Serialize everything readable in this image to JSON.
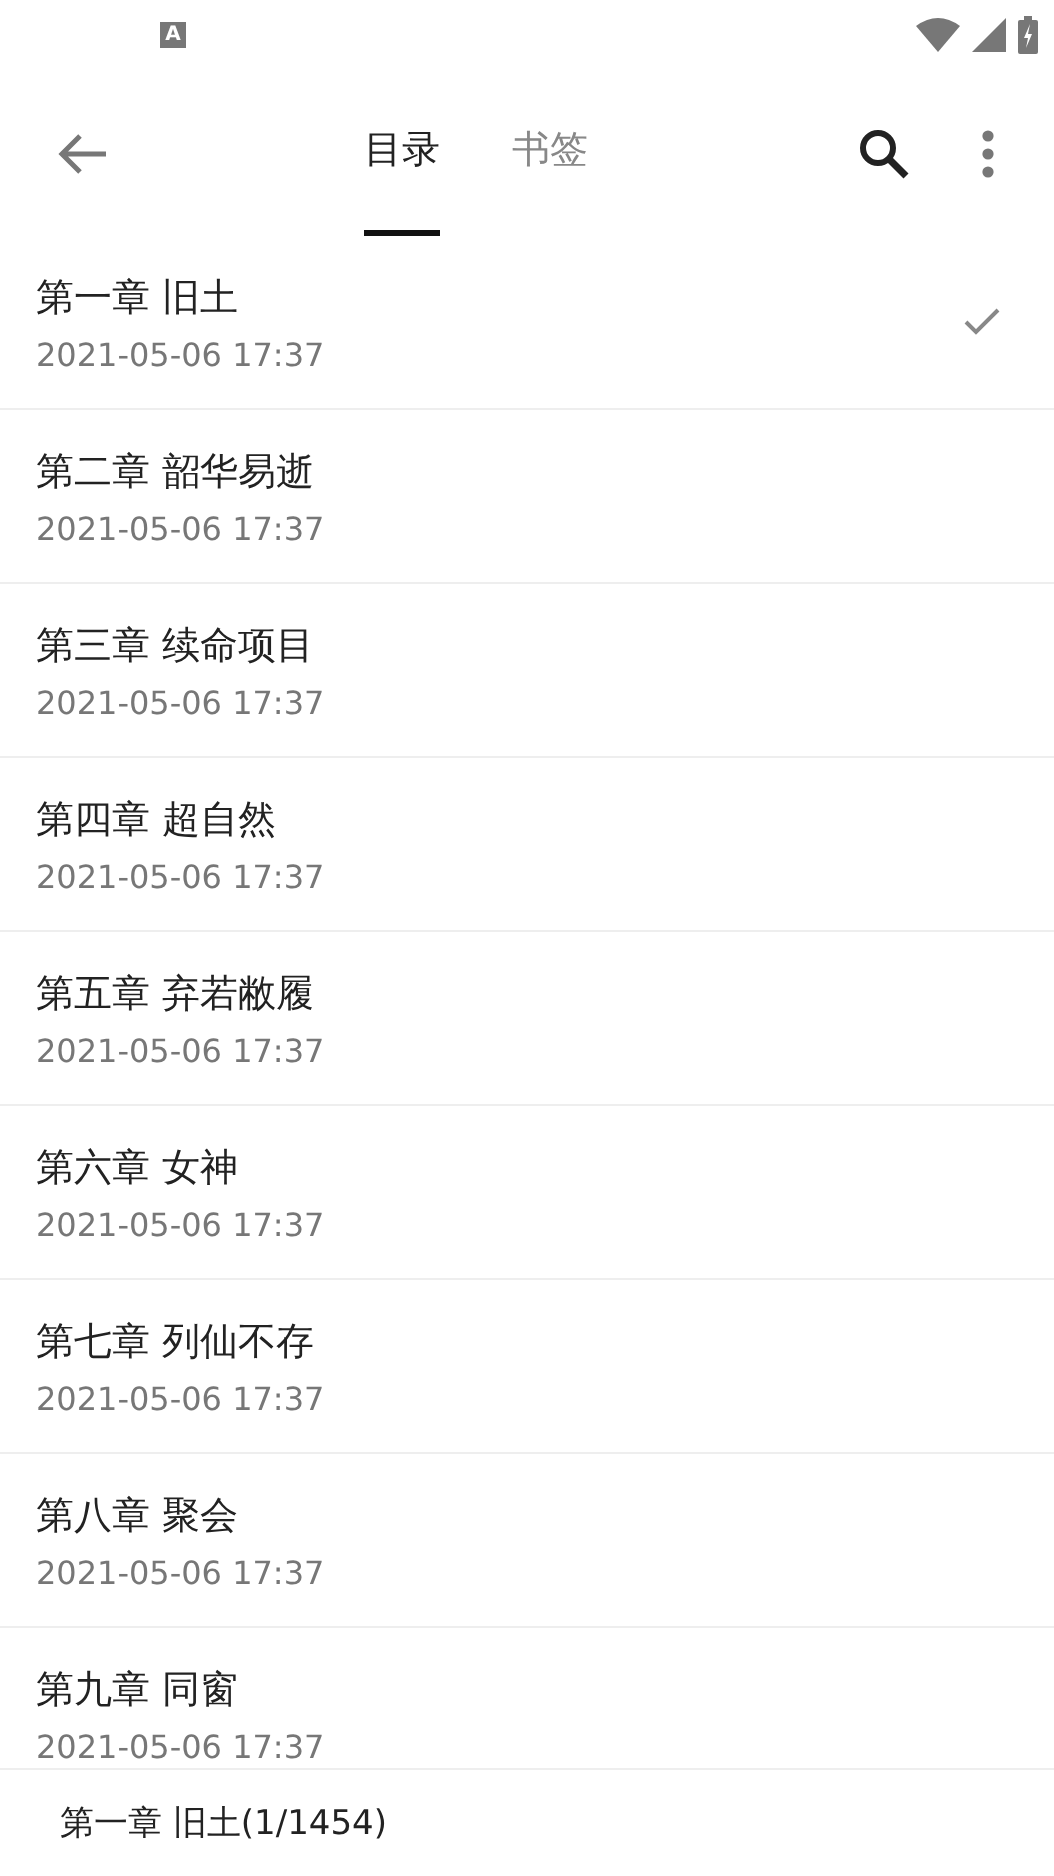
{
  "status_bar": {
    "notification": "A"
  },
  "toolbar": {
    "tabs": [
      {
        "label": "目录",
        "selected": true
      },
      {
        "label": "书签",
        "selected": false
      }
    ]
  },
  "chapters": [
    {
      "title": "第一章 旧土",
      "time": "2021-05-06 17:37",
      "current": true
    },
    {
      "title": "第二章 韶华易逝",
      "time": "2021-05-06 17:37",
      "current": false
    },
    {
      "title": "第三章 续命项目",
      "time": "2021-05-06 17:37",
      "current": false
    },
    {
      "title": "第四章 超自然",
      "time": "2021-05-06 17:37",
      "current": false
    },
    {
      "title": "第五章 弃若敝履",
      "time": "2021-05-06 17:37",
      "current": false
    },
    {
      "title": "第六章 女神",
      "time": "2021-05-06 17:37",
      "current": false
    },
    {
      "title": "第七章 列仙不存",
      "time": "2021-05-06 17:37",
      "current": false
    },
    {
      "title": "第八章 聚会",
      "time": "2021-05-06 17:37",
      "current": false
    },
    {
      "title": "第九章 同窗",
      "time": "2021-05-06 17:37",
      "current": false
    }
  ],
  "footer": {
    "position": "第一章 旧土(1/1454)"
  }
}
